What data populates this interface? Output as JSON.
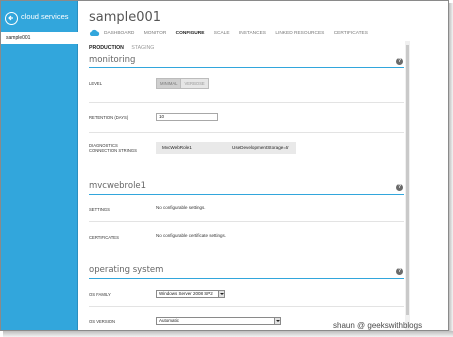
{
  "nav": {
    "title": "cloud services",
    "items": [
      "sample001"
    ]
  },
  "header": {
    "title": "sample001",
    "tabs": [
      "DASHBOARD",
      "MONITOR",
      "CONFIGURE",
      "SCALE",
      "INSTANCES",
      "LINKED RESOURCES",
      "CERTIFICATES"
    ],
    "active_tab": "CONFIGURE",
    "subtabs": [
      "PRODUCTION",
      "STAGING"
    ],
    "active_subtab": "PRODUCTION"
  },
  "monitoring": {
    "title": "monitoring",
    "level_label": "LEVEL",
    "level_options": [
      "MINIMAL",
      "VERBOSE"
    ],
    "retention_label": "RETENTION (DAYS)",
    "retention_value": "10",
    "conn_label": "DIAGNOSTICS CONNECTION STRINGS",
    "conn_role": "MvcWebRole1",
    "conn_string": "UseDevelopmentStorage=tr"
  },
  "role": {
    "title": "mvcwebrole1",
    "settings_label": "SETTINGS",
    "settings_value": "No configurable settings.",
    "certs_label": "CERTIFICATES",
    "certs_value": "No configurable certificate settings."
  },
  "os": {
    "title": "operating system",
    "family_label": "OS FAMILY",
    "family_value": "Windows Server 2008 SP2",
    "version_label": "OS VERSION",
    "version_value": "Automatic"
  },
  "help_icon_text": "?",
  "watermark": "shaun @ geekswithblogs",
  "colors": {
    "accent": "#32a6dc",
    "rule": "#32a6dc"
  }
}
